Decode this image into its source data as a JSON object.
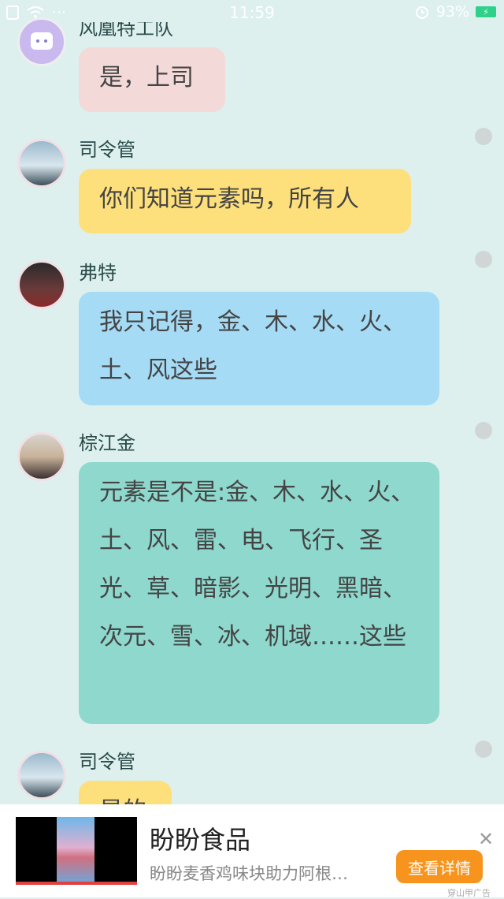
{
  "status_bar": {
    "time": "11:59",
    "battery": "93%"
  },
  "messages": [
    {
      "name": "风凰特工队",
      "text": "是，上司",
      "bubble_color": "#f3d9d8"
    },
    {
      "name": "司令管",
      "text": "你们知道元素吗，所有人",
      "bubble_color": "#fde07c"
    },
    {
      "name": "弗特",
      "text": "我只记得，金、木、水、火、土、风这些",
      "bubble_color": "#a6dbf5"
    },
    {
      "name": "棕江金",
      "text": "元素是不是:金、木、水、火、土、风、雷、电、飞行、圣光、草、暗影、光明、黑暗、次元、雪、冰、机域……这些",
      "bubble_color": "#8ed8ce"
    },
    {
      "name": "司令管",
      "text": "是的",
      "bubble_color": "#fde07c"
    }
  ],
  "ad": {
    "title": "盼盼食品",
    "description": "盼盼麦香鸡味块助力阿根…",
    "button": "查看详情",
    "tag": "穿山甲广告",
    "close": "✕"
  }
}
